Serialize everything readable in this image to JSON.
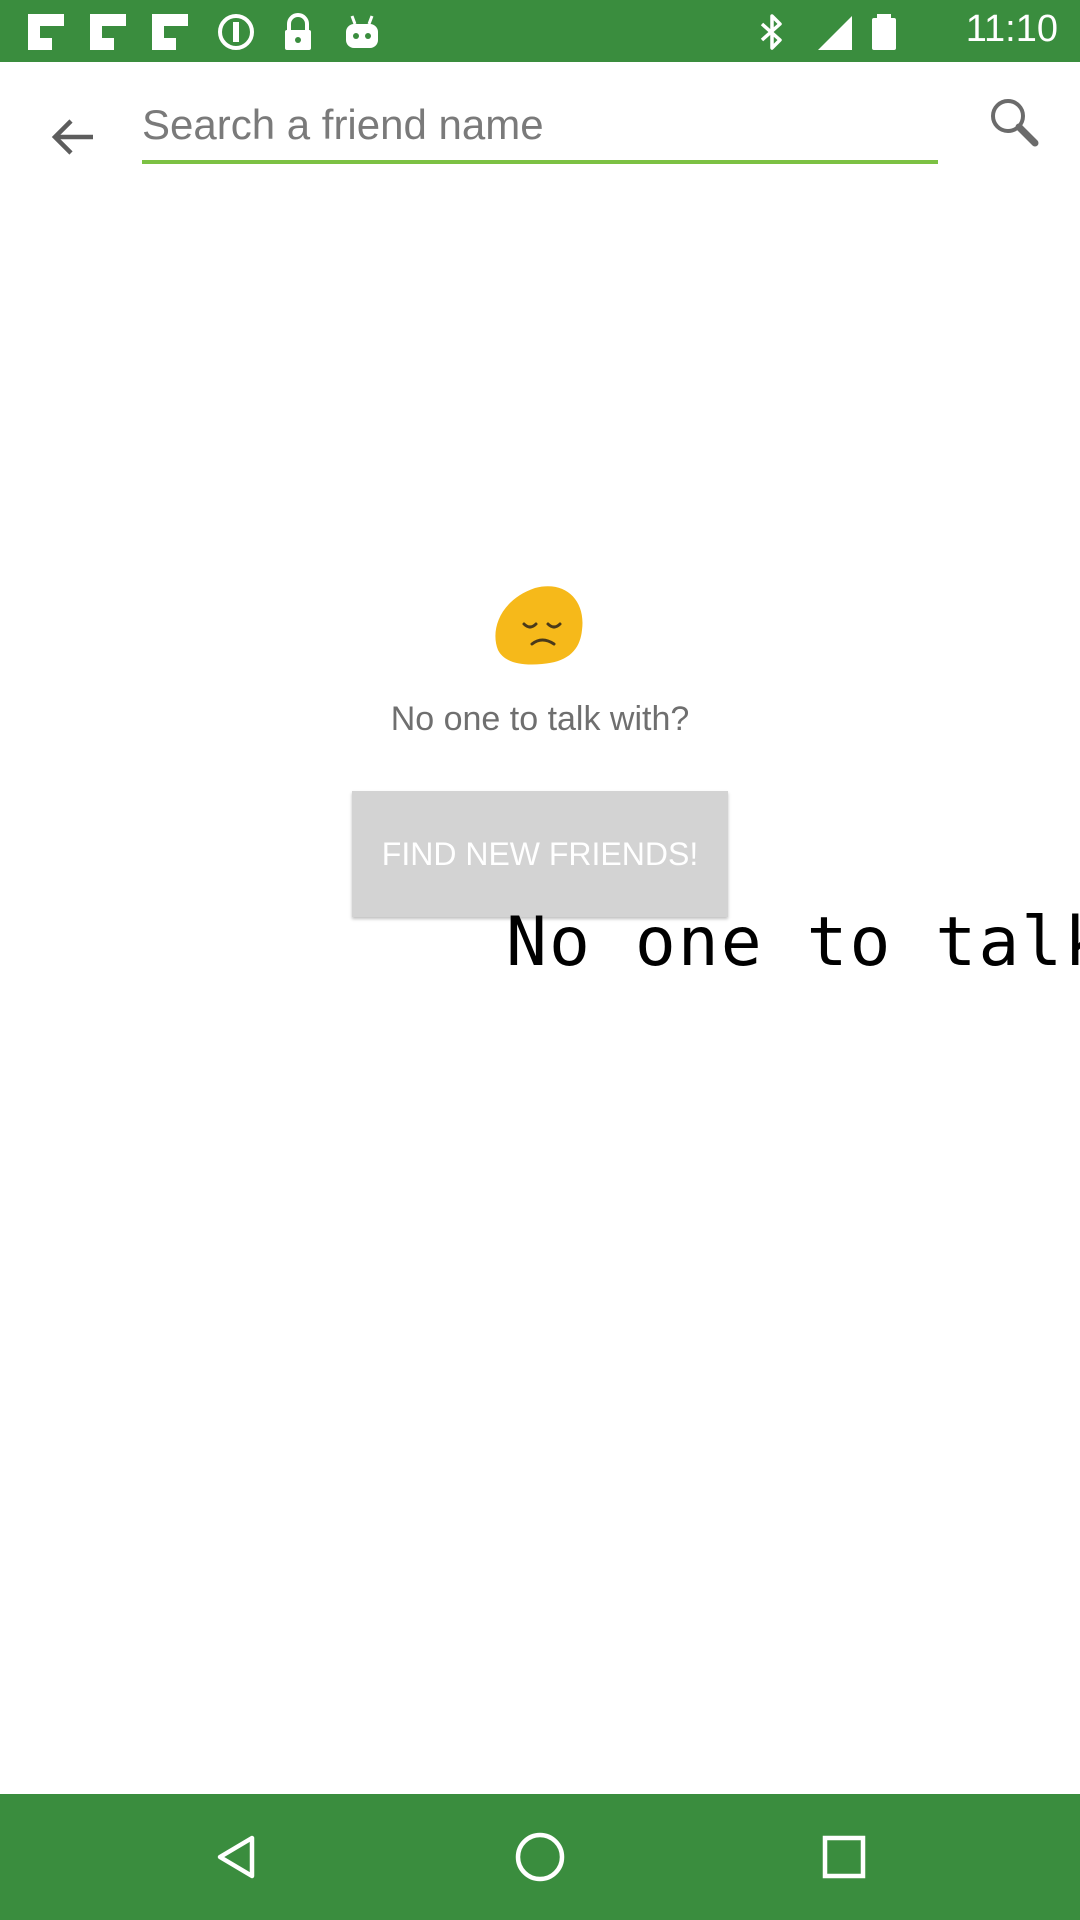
{
  "status_bar": {
    "time": "11:10",
    "left_icons": [
      "flipboard-icon",
      "flipboard-icon",
      "flipboard-icon",
      "alert-icon",
      "lock-icon",
      "android-icon"
    ],
    "right_icons": [
      "bluetooth-icon",
      "signal-icon",
      "battery-icon"
    ],
    "background_color": "#3a8d3e"
  },
  "toolbar": {
    "search_placeholder": "Search a friend name",
    "search_value": "",
    "back_icon": "arrow-back-icon",
    "search_icon": "search-icon",
    "underline_color": "#7cc143"
  },
  "empty_state": {
    "emoji": "sad-face-emoji",
    "message": "No one to talk with?",
    "button_label": "FIND NEW FRIENDS!"
  },
  "overlay": {
    "text": "No one to talk w"
  },
  "nav_bar": {
    "back_icon": "nav-back-icon",
    "home_icon": "nav-home-icon",
    "recents_icon": "nav-recents-icon",
    "background_color": "#3a8d3e"
  }
}
